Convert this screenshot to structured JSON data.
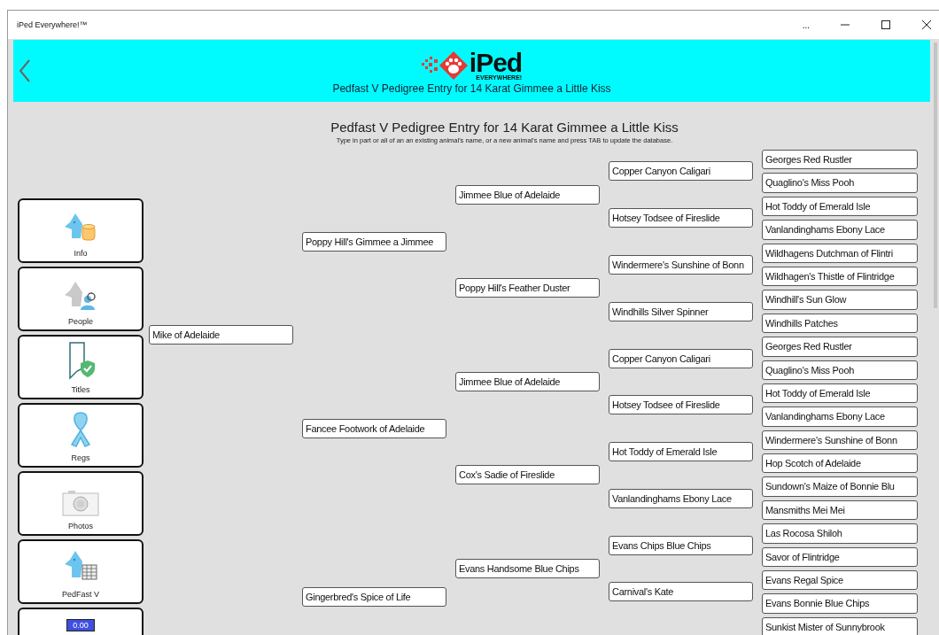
{
  "window": {
    "title": "iPed Everywhere!™",
    "more": "..."
  },
  "header": {
    "logo": {
      "name": "iPed",
      "tagline": "EVERYWHERE!"
    },
    "subtitle": "Pedfast V Pedigree Entry for 14 Karat Gimmee a Little Kiss"
  },
  "page": {
    "title": "Pedfast V Pedigree Entry for 14 Karat Gimmee a Little Kiss",
    "instructions": "Type in part or all of an an existing animal's name, or a new animal's name and press TAB to update the database."
  },
  "sidebar": {
    "items": [
      {
        "kind": "info",
        "label": "Info"
      },
      {
        "kind": "people",
        "label": "People"
      },
      {
        "kind": "titles",
        "label": "Titles"
      },
      {
        "kind": "regs",
        "label": "Regs"
      },
      {
        "kind": "photos",
        "label": "Photos"
      },
      {
        "kind": "pedfast",
        "label": "PedFast V"
      },
      {
        "kind": "calculator",
        "display": "0.00"
      }
    ]
  },
  "pedigree": {
    "generations": [
      [
        {
          "name": "Mike of Adelaide"
        }
      ],
      [
        {
          "name": "Poppy Hill's Gimmee a Jimmee"
        },
        {
          "name": "Fancee Footwork of Adelaide"
        },
        {
          "name": "Gingerbred's Spice of Life"
        }
      ],
      [
        {
          "name": "Jimmee Blue of Adelaide"
        },
        {
          "name": "Poppy Hill's Feather Duster"
        },
        {
          "name": "Jimmee Blue of Adelaide"
        },
        {
          "name": "Cox's Sadie of Fireslide"
        },
        {
          "name": "Evans Handsome Blue Chips"
        }
      ],
      [
        {
          "name": "Copper Canyon Caligari"
        },
        {
          "name": "Hotsey Todsee of Fireslide"
        },
        {
          "name": "Windermere's Sunshine of Bonn"
        },
        {
          "name": "Windhills Silver Spinner"
        },
        {
          "name": "Copper Canyon Caligari"
        },
        {
          "name": "Hotsey Todsee of Fireslide"
        },
        {
          "name": "Hot Toddy of Emerald Isle"
        },
        {
          "name": "Vanlandinghams Ebony Lace"
        },
        {
          "name": "Evans Chips Blue Chips"
        },
        {
          "name": "Carnival's Kate"
        }
      ],
      [
        {
          "name": "Georges Red Rustler"
        },
        {
          "name": "Quaglino's Miss Pooh"
        },
        {
          "name": "Hot Toddy of Emerald Isle"
        },
        {
          "name": "Vanlandinghams Ebony Lace"
        },
        {
          "name": "Wildhagens Dutchman of Flintri"
        },
        {
          "name": "Wildhagen's Thistle of Flintridge"
        },
        {
          "name": "Windhill's Sun Glow"
        },
        {
          "name": "Windhills Patches"
        },
        {
          "name": "Georges Red Rustler"
        },
        {
          "name": "Quaglino's Miss Pooh"
        },
        {
          "name": "Hot Toddy of Emerald Isle"
        },
        {
          "name": "Vanlandinghams Ebony Lace"
        },
        {
          "name": "Windermere's Sunshine of Bonn"
        },
        {
          "name": "Hop Scotch of Adelaide"
        },
        {
          "name": "Sundown's Maize of Bonnie Blu"
        },
        {
          "name": "Mansmiths Mei Mei"
        },
        {
          "name": "Las Rocosa Shiloh"
        },
        {
          "name": "Savor of Flintridge"
        },
        {
          "name": "Evans Regal Spice"
        },
        {
          "name": "Evans Bonnie Blue Chips"
        },
        {
          "name": "Sunkist Mister of Sunnybrook"
        }
      ]
    ]
  }
}
